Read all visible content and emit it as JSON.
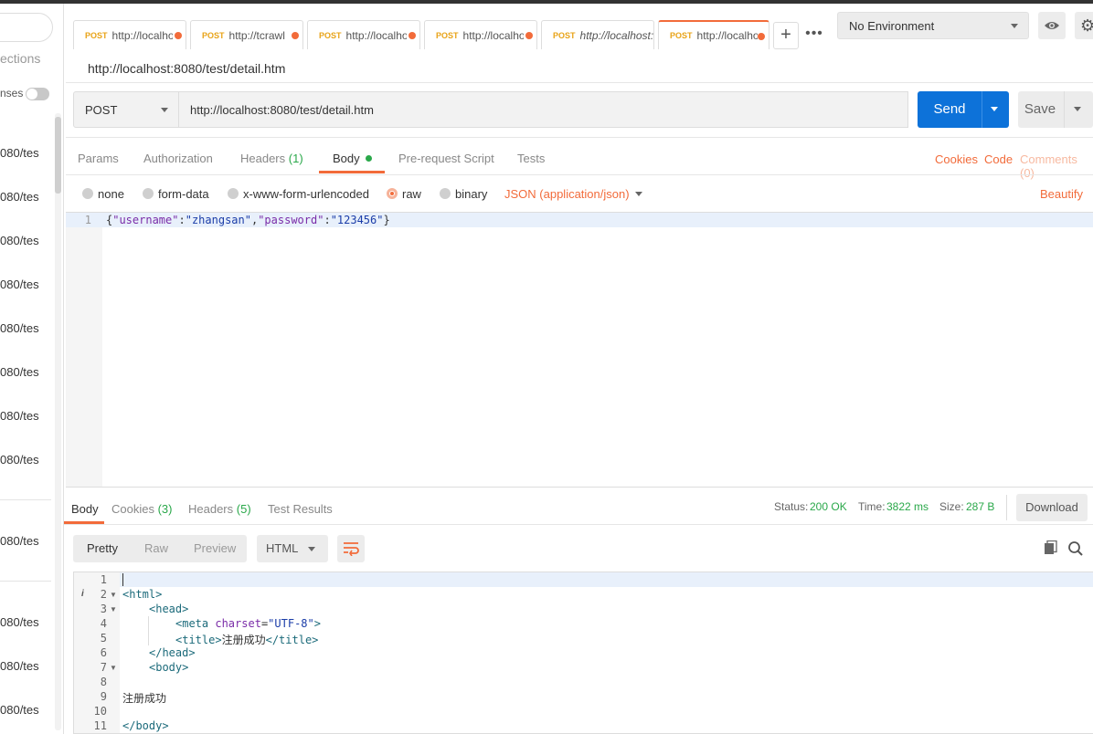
{
  "sidebar": {
    "collections_label": "ections",
    "responses_label": "nses",
    "items": [
      "080/tes",
      "080/tes",
      "080/tes",
      "080/tes",
      "080/tes",
      "080/tes",
      "080/tes",
      "080/tes",
      "080/tes",
      "080/tes",
      "080/tes"
    ]
  },
  "tabs": [
    {
      "method": "POST",
      "url": "http://localhost:8080/test/detail.htm"
    },
    {
      "method": "POST",
      "url": "http://tcrawl"
    },
    {
      "method": "POST",
      "url": "http://localhost:8080/test/detail.htm"
    },
    {
      "method": "POST",
      "url": "http://localhost:8080/test/detail.htm"
    },
    {
      "method": "POST",
      "url": "http://localhost:"
    },
    {
      "method": "POST",
      "url": "http://localhost:8080/test/detail.htm"
    }
  ],
  "environment": {
    "selected": "No Environment"
  },
  "request": {
    "title": "http://localhost:8080/test/detail.htm",
    "method": "POST",
    "url": "http://localhost:8080/test/detail.htm",
    "send_label": "Send",
    "save_label": "Save"
  },
  "request_tabs": {
    "params": "Params",
    "authorization": "Authorization",
    "headers": "Headers",
    "headers_count": "(1)",
    "body": "Body",
    "prerequest": "Pre-request Script",
    "tests": "Tests",
    "cookies": "Cookies",
    "code": "Code",
    "comments": "Comments (0)"
  },
  "body_types": {
    "none": "none",
    "form_data": "form-data",
    "urlencoded": "x-www-form-urlencoded",
    "raw": "raw",
    "binary": "binary",
    "content_type": "JSON (application/json)",
    "beautify": "Beautify"
  },
  "editor": {
    "line_no": "1",
    "tokens": [
      "{",
      "\"username\"",
      ":",
      "\"zhangsan\"",
      ",",
      "\"password\"",
      ":",
      "\"123456\"",
      "}"
    ]
  },
  "response": {
    "tabs": {
      "body": "Body",
      "cookies": "Cookies",
      "cookies_count": "(3)",
      "headers": "Headers",
      "headers_count": "(5)",
      "test_results": "Test Results"
    },
    "status_label": "Status:",
    "status_value": "200 OK",
    "time_label": "Time:",
    "time_value": "3822 ms",
    "size_label": "Size:",
    "size_value": "287 B",
    "download_label": "Download",
    "views": {
      "pretty": "Pretty",
      "raw": "Raw",
      "preview": "Preview",
      "format": "HTML"
    },
    "lines": [
      "1",
      "2",
      "3",
      "4",
      "5",
      "6",
      "7",
      "8",
      "9",
      "10",
      "11"
    ],
    "code": {
      "l2": "<html>",
      "l3": "<head>",
      "l4_open": "<meta ",
      "l4_attr": "charset",
      "l4_eq": "=",
      "l4_val": "\"UTF-8\"",
      "l4_close": ">",
      "l5_open": "<title>",
      "l5_text": "注册成功",
      "l5_close": "</title>",
      "l6": "</head>",
      "l7": "<body>",
      "l9": "注册成功",
      "l11": "</body>"
    }
  },
  "colors": {
    "accent": "#f26b3a",
    "send": "#0d72d9",
    "success": "#2aa84a"
  },
  "icons": [
    "eye-icon",
    "gear-icon",
    "plus-icon",
    "more-icon",
    "caret-down-icon",
    "wrap-icon",
    "copy-icon",
    "search-icon",
    "info-icon"
  ]
}
